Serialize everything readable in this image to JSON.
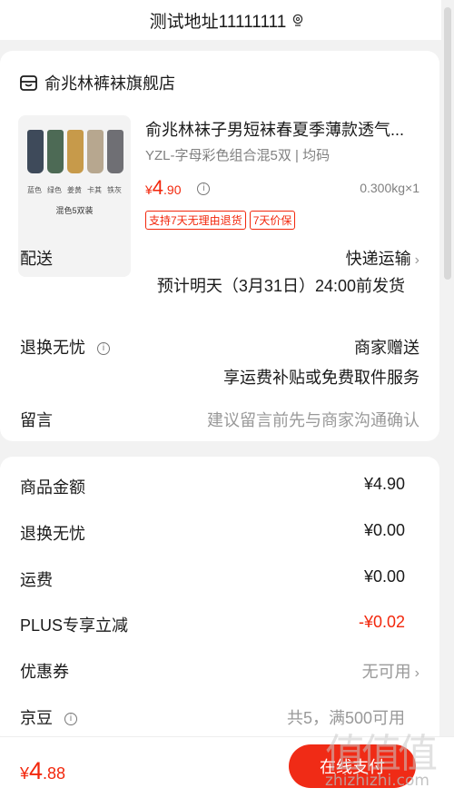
{
  "address": {
    "text": "测试地址11111111",
    "icon": "location-pin-icon"
  },
  "shop": {
    "name": "俞兆林裤袜旗舰店",
    "icon": "store-icon"
  },
  "product": {
    "title": "俞兆林袜子男短袜春夏季薄款透气...",
    "spec": "YZL-字母彩色组合混5双 | 均码",
    "price_symbol": "¥",
    "price_int": "4",
    "price_dec": ".90",
    "weight_qty": "0.300kg×1",
    "tags": [
      "支持7天无理由退货",
      "7天价保"
    ],
    "image": {
      "sock_labels": [
        "蓝色",
        "绿色",
        "姜黄",
        "卡其",
        "铁灰"
      ],
      "sock_colors": [
        "#3e4a5a",
        "#4d6a55",
        "#c79a4a",
        "#b7a78f",
        "#6f6f74"
      ],
      "caption": "混色5双装"
    }
  },
  "delivery": {
    "label": "配送",
    "method": "快递运输",
    "eta": "预计明天（3月31日）24:00前发货"
  },
  "return_worry": {
    "label": "退换无忧",
    "value": "商家赠送",
    "detail": "享运费补贴或免费取件服务"
  },
  "message": {
    "label": "留言",
    "placeholder": "建议留言前先与商家沟通确认"
  },
  "summary": [
    {
      "label": "商品金额",
      "value": "¥4.90",
      "style": "normal"
    },
    {
      "label": "退换无忧",
      "value": "¥0.00",
      "style": "normal"
    },
    {
      "label": "运费",
      "value": "¥0.00",
      "style": "normal"
    },
    {
      "label": "PLUS专享立减",
      "value": "-¥0.02",
      "style": "red"
    },
    {
      "label": "优惠券",
      "value": "无可用",
      "style": "grey"
    },
    {
      "label": "京豆",
      "value": "共5，满500可用",
      "style": "grey"
    }
  ],
  "bottom": {
    "symbol": "¥",
    "total_int": "4",
    "total_dec": ".88",
    "pay_label": "在线支付"
  },
  "watermark": {
    "glyphs": "值值值",
    "url": "zhizhizhi.com"
  },
  "colors": {
    "accent_red": "#f2270c",
    "pay_button": "#f02b16",
    "grey_text": "#808080"
  }
}
